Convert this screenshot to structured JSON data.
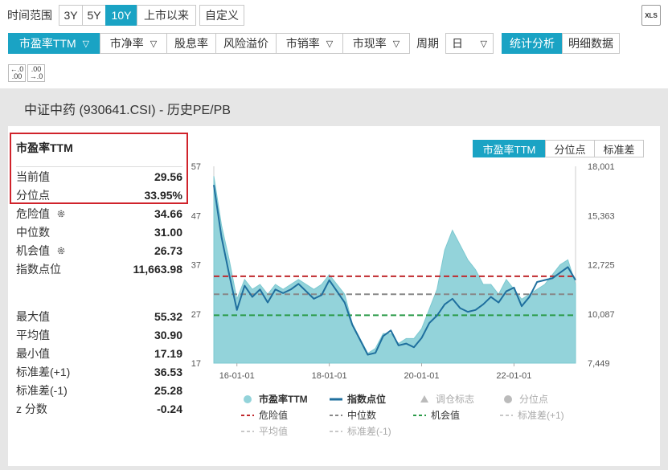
{
  "range": {
    "label": "时间范围",
    "options": [
      "3Y",
      "5Y",
      "10Y",
      "上市以来",
      "自定义"
    ],
    "active": 2
  },
  "export_label": "XLS",
  "metrics": {
    "tabs": [
      "市盈率TTM",
      "市净率",
      "股息率",
      "风险溢价",
      "市销率",
      "市现率"
    ],
    "active": 0
  },
  "period": {
    "label": "周期",
    "value": "日"
  },
  "view_tabs": {
    "items": [
      "统计分析",
      "明细数据"
    ],
    "active": 0
  },
  "decimal_buttons": {
    "decrease": [
      "←.0",
      ".00"
    ],
    "increase": [
      ".00",
      "→.0"
    ]
  },
  "page_title": "中证中药 (930641.CSI) - 历史PE/PB",
  "stats": {
    "title": "市盈率TTM",
    "current_label": "当前值",
    "current": "29.56",
    "percentile_label": "分位点",
    "percentile": "33.95%",
    "danger_label": "危险值",
    "danger": "34.66",
    "median_label": "中位数",
    "median": "31.00",
    "chance_label": "机会值",
    "chance": "26.73",
    "index_label": "指数点位",
    "index": "11,663.98",
    "max_label": "最大值",
    "max": "55.32",
    "avg_label": "平均值",
    "avg": "30.90",
    "min_label": "最小值",
    "min": "17.19",
    "sd_plus_label": "标准差(+1)",
    "sd_plus": "36.53",
    "sd_minus_label": "标准差(-1)",
    "sd_minus": "25.28",
    "z_label": "z 分数",
    "z": "-0.24"
  },
  "chart_tabs": {
    "items": [
      "市盈率TTM",
      "分位点",
      "标准差"
    ],
    "active": 0
  },
  "colors": {
    "accent": "#1aa3c4",
    "pe_area": "#93d3da",
    "index_line": "#1f6f9e",
    "danger": "#c0282d",
    "median": "#888888",
    "chance": "#2a9a48",
    "sd": "#c8c8c8",
    "red_box": "#d0232b"
  },
  "chart_data": {
    "type": "area",
    "x_ticks": [
      "16-01-01",
      "18-01-01",
      "20-01-01",
      "22-01-01"
    ],
    "y_left_ticks": [
      57,
      47,
      37,
      27,
      17
    ],
    "y_right_ticks": [
      "18,001",
      "15,363",
      "12,725",
      "10,087",
      "7,449"
    ],
    "ylim_left": [
      17,
      57
    ],
    "ylim_right": [
      7449,
      18001
    ],
    "x": [
      "2015-07",
      "2015-09",
      "2015-11",
      "2016-01",
      "2016-03",
      "2016-05",
      "2016-07",
      "2016-09",
      "2016-11",
      "2017-01",
      "2017-03",
      "2017-05",
      "2017-07",
      "2017-09",
      "2017-11",
      "2018-01",
      "2018-03",
      "2018-05",
      "2018-07",
      "2018-09",
      "2018-11",
      "2019-01",
      "2019-03",
      "2019-05",
      "2019-07",
      "2019-09",
      "2019-11",
      "2020-01",
      "2020-03",
      "2020-05",
      "2020-07",
      "2020-09",
      "2020-11",
      "2021-01",
      "2021-03",
      "2021-05",
      "2021-07",
      "2021-09",
      "2021-11",
      "2022-01",
      "2022-03",
      "2022-05",
      "2022-07",
      "2022-09",
      "2022-11",
      "2023-01",
      "2023-03",
      "2023-05"
    ],
    "series": [
      {
        "name": "市盈率TTM",
        "values": [
          55,
          45,
          38,
          30,
          34,
          32,
          33,
          31,
          33,
          32,
          33,
          34,
          33,
          32,
          33,
          35,
          33,
          31,
          25,
          22,
          19,
          20,
          23,
          23,
          21,
          22,
          22,
          24,
          28,
          32,
          40,
          44,
          41,
          38,
          36,
          33,
          33,
          31,
          34,
          32,
          30,
          31,
          32,
          33,
          35,
          37,
          38,
          33
        ]
      },
      {
        "name": "指数点位",
        "values": [
          17000,
          14200,
          12200,
          10300,
          11600,
          11000,
          11400,
          10700,
          11400,
          11200,
          11400,
          11700,
          11300,
          10900,
          11100,
          11900,
          11300,
          10700,
          9500,
          8700,
          7900,
          8000,
          8900,
          9200,
          8400,
          8500,
          8300,
          8800,
          9600,
          10000,
          10600,
          10900,
          10400,
          10200,
          10300,
          10600,
          11000,
          10700,
          11300,
          11500,
          10500,
          11000,
          11800,
          11900,
          12000,
          12300,
          12600,
          11900
        ]
      }
    ],
    "reference_lines": [
      {
        "name": "危险值",
        "value": 34.66
      },
      {
        "name": "中位数",
        "value": 31.0
      },
      {
        "name": "机会值",
        "value": 26.73
      }
    ],
    "legend": {
      "row1": [
        "市盈率TTM",
        "指数点位",
        "调仓标志",
        "分位点"
      ],
      "row2": [
        "危险值",
        "中位数",
        "机会值",
        "标准差(+1)"
      ],
      "row3": [
        "平均值",
        "标准差(-1)"
      ]
    },
    "legend_position": "bottom"
  }
}
